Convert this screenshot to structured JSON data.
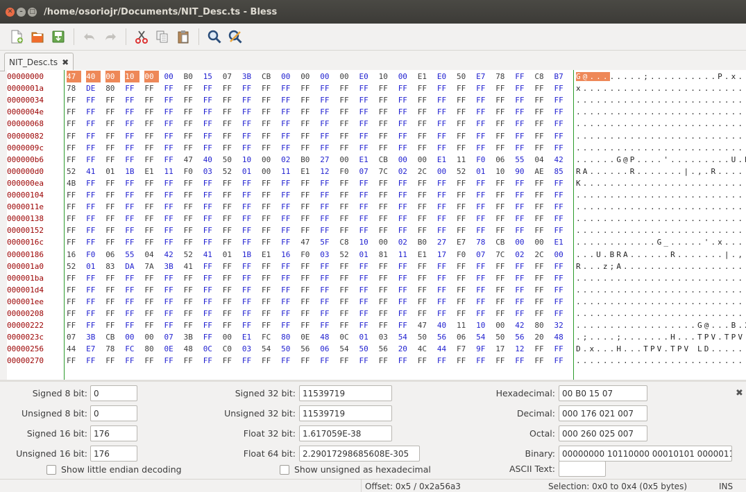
{
  "window": {
    "title": "/home/osoriojr/Documents/NIT_Desc.ts - Bless"
  },
  "toolbar": {
    "icons": [
      "new-file-icon",
      "open-file-icon",
      "save-icon",
      "undo-icon",
      "redo-icon",
      "cut-icon",
      "copy-icon",
      "paste-icon",
      "find-icon",
      "find-replace-icon"
    ]
  },
  "tab": {
    "label": "NIT_Desc.ts",
    "close": "✖"
  },
  "hex": {
    "rows": [
      {
        "offset": "00000000",
        "bytes": "47 40 00 10 00 00 B0 15 07 3B CB 00 00 00 00 E0 10 00 E1 E0 50 E7 78 FF C8 B7",
        "ascii": "G@........;..........P.x..."
      },
      {
        "offset": "0000001a",
        "bytes": "78 DE 80 FF FF FF FF FF FF FF FF FF FF FF FF FF FF FF FF FF FF FF FF FF FF FF",
        "ascii": "x........................."
      },
      {
        "offset": "00000034",
        "bytes": "FF FF FF FF FF FF FF FF FF FF FF FF FF FF FF FF FF FF FF FF FF FF FF FF FF FF",
        "ascii": ".........................."
      },
      {
        "offset": "0000004e",
        "bytes": "FF FF FF FF FF FF FF FF FF FF FF FF FF FF FF FF FF FF FF FF FF FF FF FF FF FF",
        "ascii": ".........................."
      },
      {
        "offset": "00000068",
        "bytes": "FF FF FF FF FF FF FF FF FF FF FF FF FF FF FF FF FF FF FF FF FF FF FF FF FF FF",
        "ascii": ".........................."
      },
      {
        "offset": "00000082",
        "bytes": "FF FF FF FF FF FF FF FF FF FF FF FF FF FF FF FF FF FF FF FF FF FF FF FF FF FF",
        "ascii": ".........................."
      },
      {
        "offset": "0000009c",
        "bytes": "FF FF FF FF FF FF FF FF FF FF FF FF FF FF FF FF FF FF FF FF FF FF FF FF FF FF",
        "ascii": ".........................."
      },
      {
        "offset": "000000b6",
        "bytes": "FF FF FF FF FF FF 47 40 50 10 00 02 B0 27 00 E1 CB 00 00 E1 11 F0 06 55 04 42",
        "ascii": "......G@P....'.........U.B"
      },
      {
        "offset": "000000d0",
        "bytes": "52 41 01 1B E1 11 F0 03 52 01 00 11 E1 12 F0 07 7C 02 2C 00 52 01 10 90 AE 85",
        "ascii": "RA......R.......|.,.R....."
      },
      {
        "offset": "000000ea",
        "bytes": "4B FF FF FF FF FF FF FF FF FF FF FF FF FF FF FF FF FF FF FF FF FF FF FF FF FF",
        "ascii": "K........................."
      },
      {
        "offset": "00000104",
        "bytes": "FF FF FF FF FF FF FF FF FF FF FF FF FF FF FF FF FF FF FF FF FF FF FF FF FF FF",
        "ascii": ".........................."
      },
      {
        "offset": "0000011e",
        "bytes": "FF FF FF FF FF FF FF FF FF FF FF FF FF FF FF FF FF FF FF FF FF FF FF FF FF FF",
        "ascii": ".........................."
      },
      {
        "offset": "00000138",
        "bytes": "FF FF FF FF FF FF FF FF FF FF FF FF FF FF FF FF FF FF FF FF FF FF FF FF FF FF",
        "ascii": ".........................."
      },
      {
        "offset": "00000152",
        "bytes": "FF FF FF FF FF FF FF FF FF FF FF FF FF FF FF FF FF FF FF FF FF FF FF FF FF FF",
        "ascii": ".........................."
      },
      {
        "offset": "0000016c",
        "bytes": "FF FF FF FF FF FF FF FF FF FF FF FF 47 5F C8 10 00 02 B0 27 E7 78 CB 00 00 E1",
        "ascii": "............G_.....'.x...."
      },
      {
        "offset": "00000186",
        "bytes": "16 F0 06 55 04 42 52 41 01 1B E1 16 F0 03 52 01 81 11 E1 17 F0 07 7C 02 2C 00",
        "ascii": "...U.BRA......R.......|.,."
      },
      {
        "offset": "000001a0",
        "bytes": "52 01 83 DA 7A 3B 41 FF FF FF FF FF FF FF FF FF FF FF FF FF FF FF FF FF FF FF",
        "ascii": "R...z;A..................."
      },
      {
        "offset": "000001ba",
        "bytes": "FF FF FF FF FF FF FF FF FF FF FF FF FF FF FF FF FF FF FF FF FF FF FF FF FF FF",
        "ascii": ".........................."
      },
      {
        "offset": "000001d4",
        "bytes": "FF FF FF FF FF FF FF FF FF FF FF FF FF FF FF FF FF FF FF FF FF FF FF FF FF FF",
        "ascii": ".........................."
      },
      {
        "offset": "000001ee",
        "bytes": "FF FF FF FF FF FF FF FF FF FF FF FF FF FF FF FF FF FF FF FF FF FF FF FF FF FF",
        "ascii": ".........................."
      },
      {
        "offset": "00000208",
        "bytes": "FF FF FF FF FF FF FF FF FF FF FF FF FF FF FF FF FF FF FF FF FF FF FF FF FF FF",
        "ascii": ".........................."
      },
      {
        "offset": "00000222",
        "bytes": "FF FF FF FF FF FF FF FF FF FF FF FF FF FF FF FF FF FF 47 40 11 10 00 42 80 32",
        "ascii": "..................G@...B.2"
      },
      {
        "offset": "0000023c",
        "bytes": "07 3B CB 00 00 07 3B FF 00 E1 FC 80 0E 48 0C 01 03 54 50 56 06 54 50 56 20 48",
        "ascii": ".;....;.......H...TPV.TPV H"
      },
      {
        "offset": "00000256",
        "bytes": "44 E7 78 FC 80 0E 48 0C C0 03 54 50 56 06 54 50 56 20 4C 44 F7 9F 17 12 FF FF",
        "ascii": "D.x...H...TPV.TPV LD......"
      },
      {
        "offset": "00000270",
        "bytes": "FF FF FF FF FF FF FF FF FF FF FF FF FF FF FF FF FF FF FF FF FF FF FF FF FF FF",
        "ascii": ".........................."
      }
    ]
  },
  "fields": {
    "signed8_label": "Signed 8 bit:",
    "signed8": "0",
    "unsigned8_label": "Unsigned 8 bit:",
    "unsigned8": "0",
    "signed16_label": "Signed 16 bit:",
    "signed16": "176",
    "unsigned16_label": "Unsigned 16 bit:",
    "unsigned16": "176",
    "signed32_label": "Signed 32 bit:",
    "signed32": "11539719",
    "unsigned32_label": "Unsigned 32 bit:",
    "unsigned32": "11539719",
    "float32_label": "Float 32 bit:",
    "float32": "1.617059E-38",
    "float64_label": "Float 64 bit:",
    "float64": "2.29017298685608E-305",
    "hex_label": "Hexadecimal:",
    "hex": "00 B0 15 07",
    "dec_label": "Decimal:",
    "dec": "000 176 021 007",
    "oct_label": "Octal:",
    "oct": "000 260 025 007",
    "bin_label": "Binary:",
    "bin": "00000000 10110000 00010101 0000011",
    "ascii_label": "ASCII Text:",
    "ascii": ""
  },
  "options": {
    "little_endian": "Show little endian decoding",
    "unsigned_hex": "Show unsigned as hexadecimal"
  },
  "status": {
    "offset": "Offset: 0x5 / 0x2a56a3",
    "selection": "Selection: 0x0 to 0x4 (0x5 bytes)",
    "mode": "INS"
  },
  "colors": {
    "selection": "#ee8858",
    "offset_text": "#9b0000",
    "byte_blue": "#1f1fd0",
    "column_line": "#2c9a2c"
  }
}
